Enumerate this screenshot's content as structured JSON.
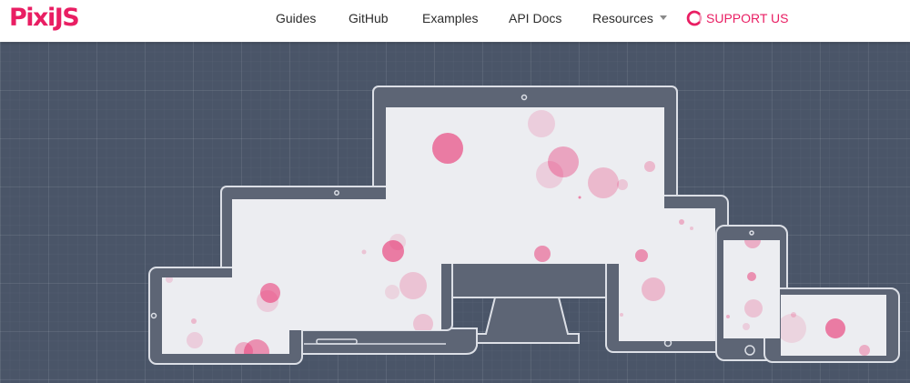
{
  "brand": {
    "logo_text": "PixiJS",
    "accent_color": "#e91e63"
  },
  "nav": {
    "items": [
      {
        "label": "Guides"
      },
      {
        "label": "GitHub"
      },
      {
        "label": "Examples"
      },
      {
        "label": "API Docs"
      },
      {
        "label": "Resources",
        "has_dropdown": true
      }
    ],
    "support": {
      "label": "SUPPORT US",
      "icon": "open-collective-icon"
    }
  },
  "hero": {
    "illustration": "responsive-devices-illustration",
    "devices": [
      "desktop-monitor",
      "laptop",
      "tablet-landscape",
      "tablet-portrait",
      "phone-portrait",
      "phone-landscape"
    ],
    "colors": {
      "background": "#4a5568",
      "device_frame": "#5d6575",
      "device_outline": "#dcdfe6",
      "screen": "#ecedf1",
      "bubble": "#e91e63"
    }
  }
}
